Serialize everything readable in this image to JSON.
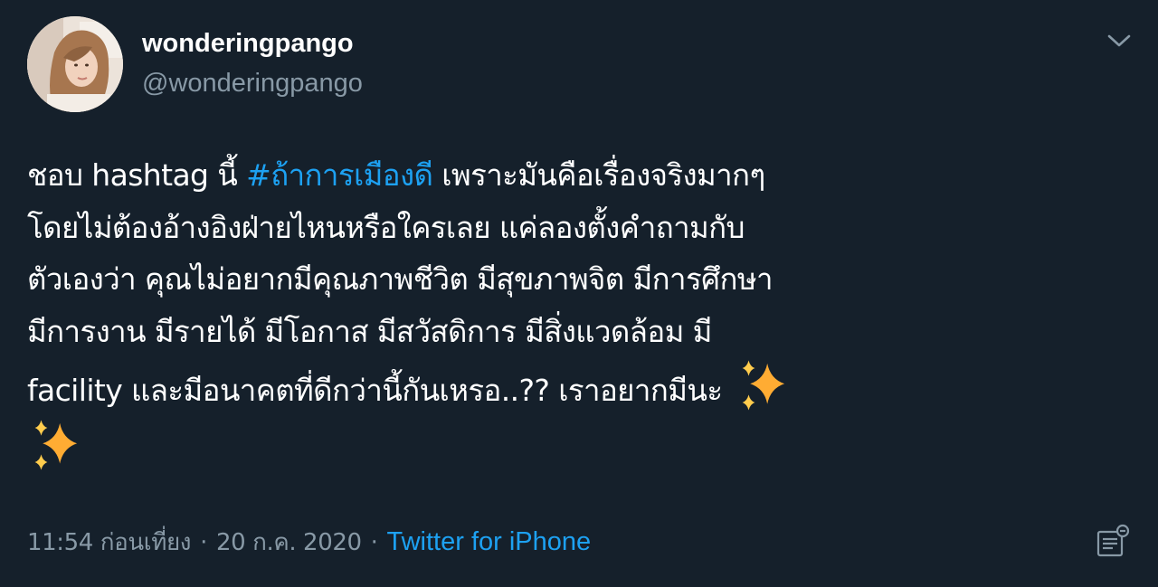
{
  "user": {
    "display_name": "wonderingpango",
    "handle": "@wonderingpango",
    "avatar_icon": "profile-photo"
  },
  "tweet": {
    "lines": [
      [
        "ชอบ hashtag นี้ ",
        "#ถ้าการเมืองดี",
        " เพราะมันคือเรื่องจริงมากๆ"
      ],
      [
        "โดยไม่ต้องอ้างอิงฝ่ายไหนหรือใครเลย แค่ลองตั้งคำถามกับ"
      ],
      [
        "ตัวเองว่า คุณไม่อยากมีคุณภาพชีวิต มีสุขภาพจิต มีการศึกษา"
      ],
      [
        "มีการงาน มีรายได้ มีโอกาส มีสวัสดิการ มีสิ่งแวดล้อม มี"
      ],
      [
        "facility และมีอนาคตที่ดีกว่านี้กันเหรอ..?? เราอยากมีนะ "
      ]
    ],
    "hashtag": "#ถ้าการเมืองดี",
    "emoji": "sparkles"
  },
  "meta": {
    "time": "11:54 ก่อนเที่ยง",
    "separator": "·",
    "date": "20 ก.ค. 2020",
    "source": "Twitter for iPhone"
  },
  "colors": {
    "background": "#15202b",
    "accent": "#1da1f2",
    "secondary_text": "#8899a6",
    "sparkle": "#ffac33"
  },
  "icons": {
    "caret": "chevron-down-icon",
    "analytics": "analytics-icon"
  }
}
